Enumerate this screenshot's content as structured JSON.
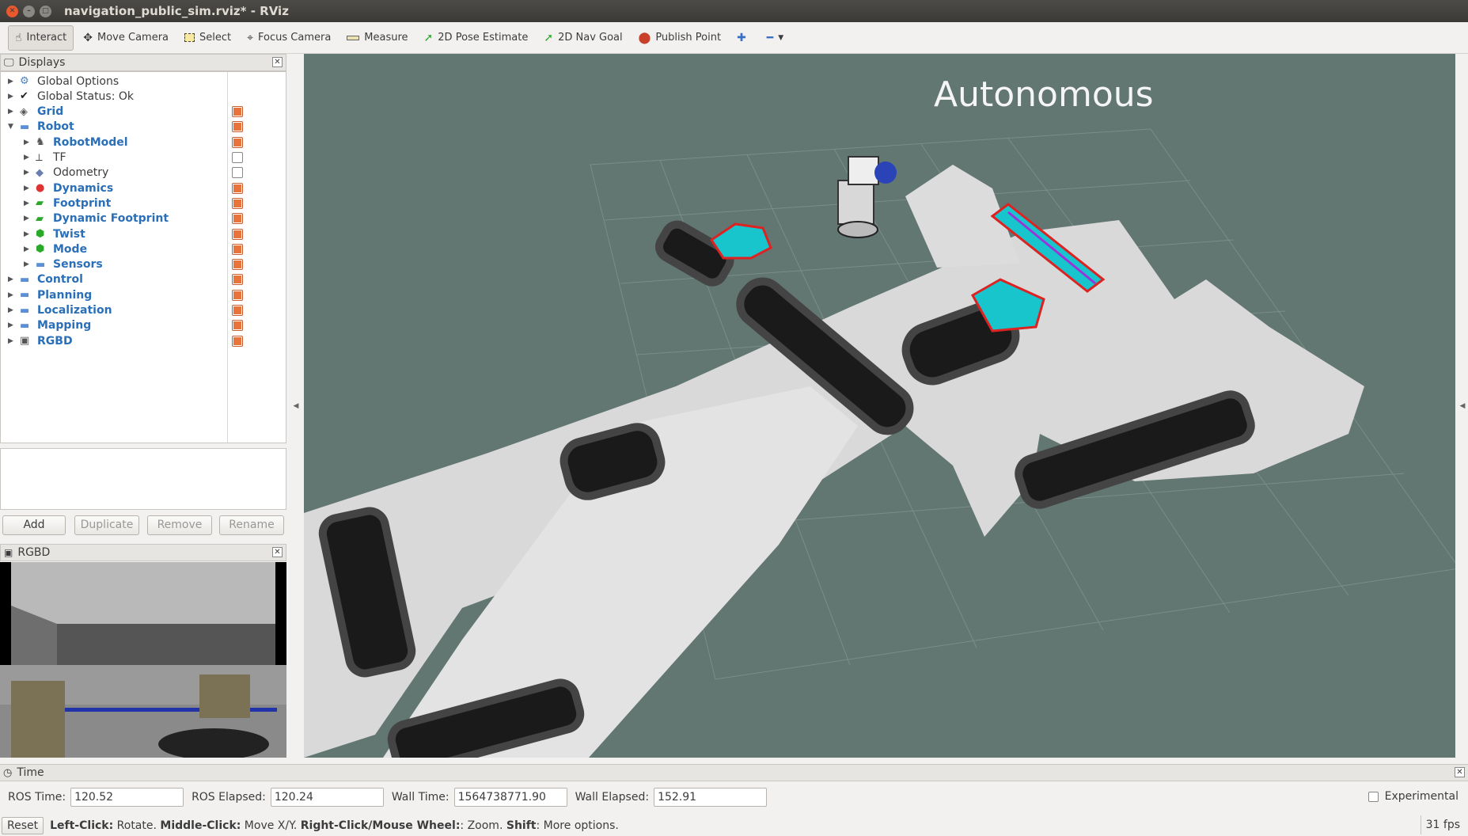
{
  "window": {
    "title": "navigation_public_sim.rviz* - RViz"
  },
  "toolbar": {
    "interact": "Interact",
    "move_camera": "Move Camera",
    "select": "Select",
    "focus_camera": "Focus Camera",
    "measure": "Measure",
    "pose_estimate": "2D Pose Estimate",
    "nav_goal": "2D Nav Goal",
    "publish_point": "Publish Point"
  },
  "displays": {
    "title": "Displays",
    "items": [
      {
        "label": "Global Options",
        "level": 0,
        "icon": "gear-icon",
        "blue": false,
        "check": null
      },
      {
        "label": "Global Status: Ok",
        "level": 0,
        "icon": "check-icon",
        "blue": false,
        "check": null
      },
      {
        "label": "Grid",
        "level": 0,
        "icon": "grid-icon",
        "blue": true,
        "check": true
      },
      {
        "label": "Robot",
        "level": 0,
        "icon": "folder-icon",
        "blue": true,
        "check": true,
        "expanded": true
      },
      {
        "label": "RobotModel",
        "level": 1,
        "icon": "robot-icon",
        "blue": true,
        "check": true
      },
      {
        "label": "TF",
        "level": 1,
        "icon": "axes-icon",
        "blue": false,
        "check": false
      },
      {
        "label": "Odometry",
        "level": 1,
        "icon": "diamond-icon",
        "blue": false,
        "check": false
      },
      {
        "label": "Dynamics",
        "level": 1,
        "icon": "markers-icon",
        "blue": true,
        "check": true
      },
      {
        "label": "Footprint",
        "level": 1,
        "icon": "polygon-icon",
        "blue": true,
        "check": true
      },
      {
        "label": "Dynamic Footprint",
        "level": 1,
        "icon": "polygon-icon",
        "blue": true,
        "check": true
      },
      {
        "label": "Twist",
        "level": 1,
        "icon": "cube-icon",
        "blue": true,
        "check": true
      },
      {
        "label": "Mode",
        "level": 1,
        "icon": "cube-icon",
        "blue": true,
        "check": true
      },
      {
        "label": "Sensors",
        "level": 1,
        "icon": "folder-icon",
        "blue": true,
        "check": true
      },
      {
        "label": "Control",
        "level": 0,
        "icon": "folder-icon",
        "blue": true,
        "check": true
      },
      {
        "label": "Planning",
        "level": 0,
        "icon": "folder-icon",
        "blue": true,
        "check": true
      },
      {
        "label": "Localization",
        "level": 0,
        "icon": "folder-icon",
        "blue": true,
        "check": true
      },
      {
        "label": "Mapping",
        "level": 0,
        "icon": "folder-icon",
        "blue": true,
        "check": true
      },
      {
        "label": "RGBD",
        "level": 0,
        "icon": "camera-icon",
        "blue": true,
        "check": true
      }
    ],
    "buttons": {
      "add": "Add",
      "duplicate": "Duplicate",
      "remove": "Remove",
      "rename": "Rename"
    }
  },
  "rgbd": {
    "title": "RGBD"
  },
  "viewport": {
    "overlay_text": "Autonomous",
    "background": "#627672"
  },
  "time": {
    "title": "Time",
    "ros_time_label": "ROS Time:",
    "ros_time": "120.52",
    "ros_elapsed_label": "ROS Elapsed:",
    "ros_elapsed": "120.24",
    "wall_time_label": "Wall Time:",
    "wall_time": "1564738771.90",
    "wall_elapsed_label": "Wall Elapsed:",
    "wall_elapsed": "152.91",
    "experimental": "Experimental"
  },
  "status": {
    "reset": "Reset",
    "hint_left_b": "Left-Click:",
    "hint_left": " Rotate. ",
    "hint_mid_b": "Middle-Click:",
    "hint_mid": " Move X/Y. ",
    "hint_right_b": "Right-Click/Mouse Wheel:",
    "hint_right": ": Zoom. ",
    "hint_shift_b": "Shift",
    "hint_shift": ": More options.",
    "fps": "31 fps"
  }
}
